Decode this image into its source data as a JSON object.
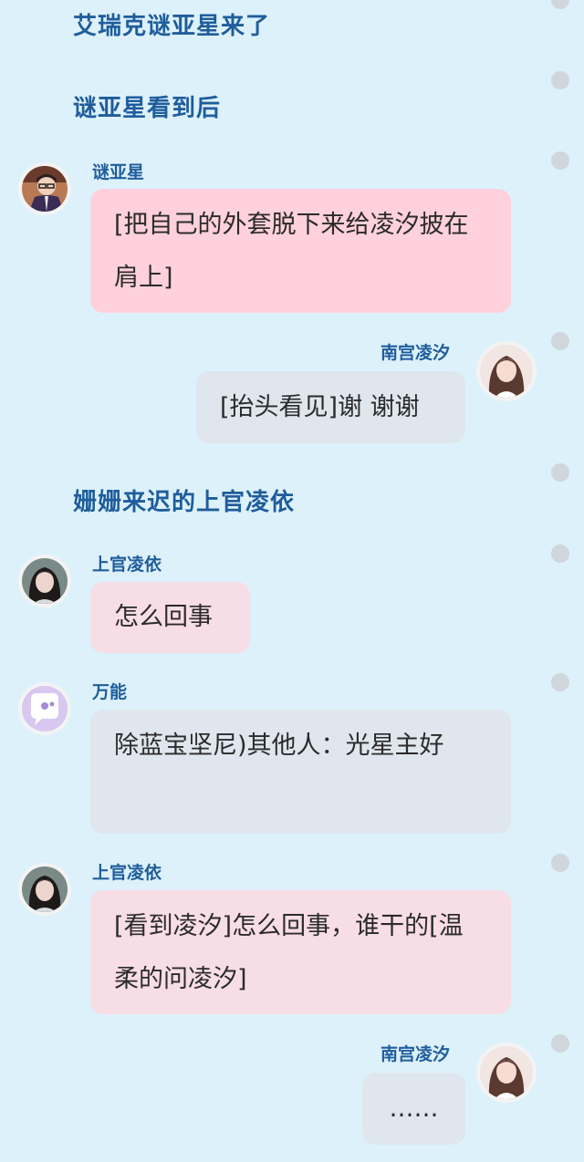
{
  "narrations": [
    "艾瑞克谜亚星来了",
    "谜亚星看到后",
    "姗姗来迟的上官凌依"
  ],
  "messages": [
    {
      "sender": "谜亚星",
      "side": "left",
      "avatar": "boy-avatar",
      "text": "[把自己的外套脱下来给凌汐披在肩上]",
      "color": "#ffd1dc"
    },
    {
      "sender": "南宫凌汐",
      "side": "right",
      "avatar": "girl-avatar",
      "text": "[抬头看见]谢 谢谢",
      "color": "#dfe6ee"
    },
    {
      "sender": "上官凌依",
      "side": "left",
      "avatar": "girl2-avatar",
      "text": "怎么回事",
      "color": "#f7dde5"
    },
    {
      "sender": "万能",
      "side": "left",
      "avatar": "chat-bubble-avatar",
      "text": "除蓝宝坚尼)其他人：光星主好",
      "color": "#dfe6ee"
    },
    {
      "sender": "上官凌依",
      "side": "left",
      "avatar": "girl2-avatar",
      "text": "[看到凌汐]怎么回事，谁干的[温柔的问凌汐]",
      "color": "#f7dde5"
    },
    {
      "sender": "南宫凌汐",
      "side": "right",
      "avatar": "girl-avatar",
      "text": "……",
      "color": "#dfe6ee"
    }
  ]
}
